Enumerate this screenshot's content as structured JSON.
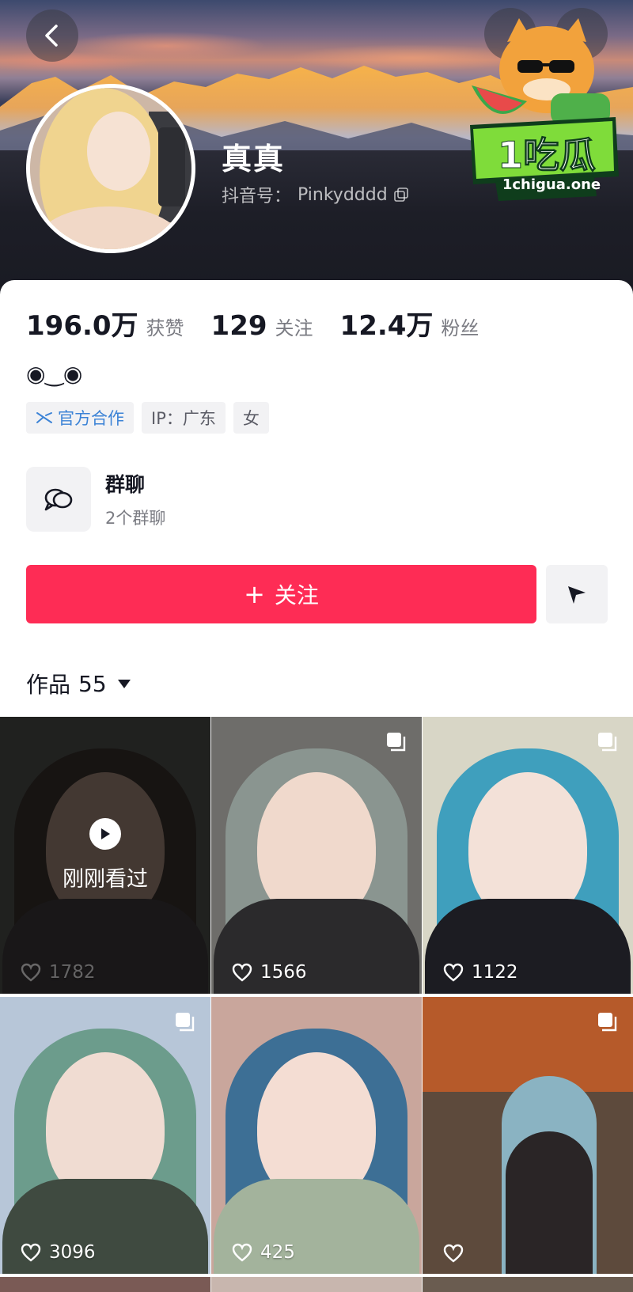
{
  "header": {
    "nickname": "真真",
    "douyin_id_label": "抖音号：",
    "douyin_id": "Pinkydddd",
    "watermark_text": "1吃瓜",
    "watermark_url": "1chigua.one"
  },
  "stats": [
    {
      "value": "196.0万",
      "label": "获赞"
    },
    {
      "value": "129",
      "label": "关注"
    },
    {
      "value": "12.4万",
      "label": "粉丝"
    }
  ],
  "bio": "◉‿◉",
  "tags": {
    "official": "官方合作",
    "ip": "IP：广东",
    "gender": "女"
  },
  "group_chat": {
    "title": "群聊",
    "subtitle": "2个群聊"
  },
  "actions": {
    "follow_label": "关注",
    "follow_plus": "+"
  },
  "works": {
    "label": "作品",
    "count": "55"
  },
  "grid": {
    "watched_label": "刚刚看过",
    "items": [
      {
        "likes": "1782"
      },
      {
        "likes": "1566"
      },
      {
        "likes": "1122"
      },
      {
        "likes": "3096"
      },
      {
        "likes": "425"
      },
      {
        "likes": ""
      }
    ]
  },
  "colors": {
    "follow_red": "#fe2c55",
    "official_blue": "#3c83d6"
  }
}
